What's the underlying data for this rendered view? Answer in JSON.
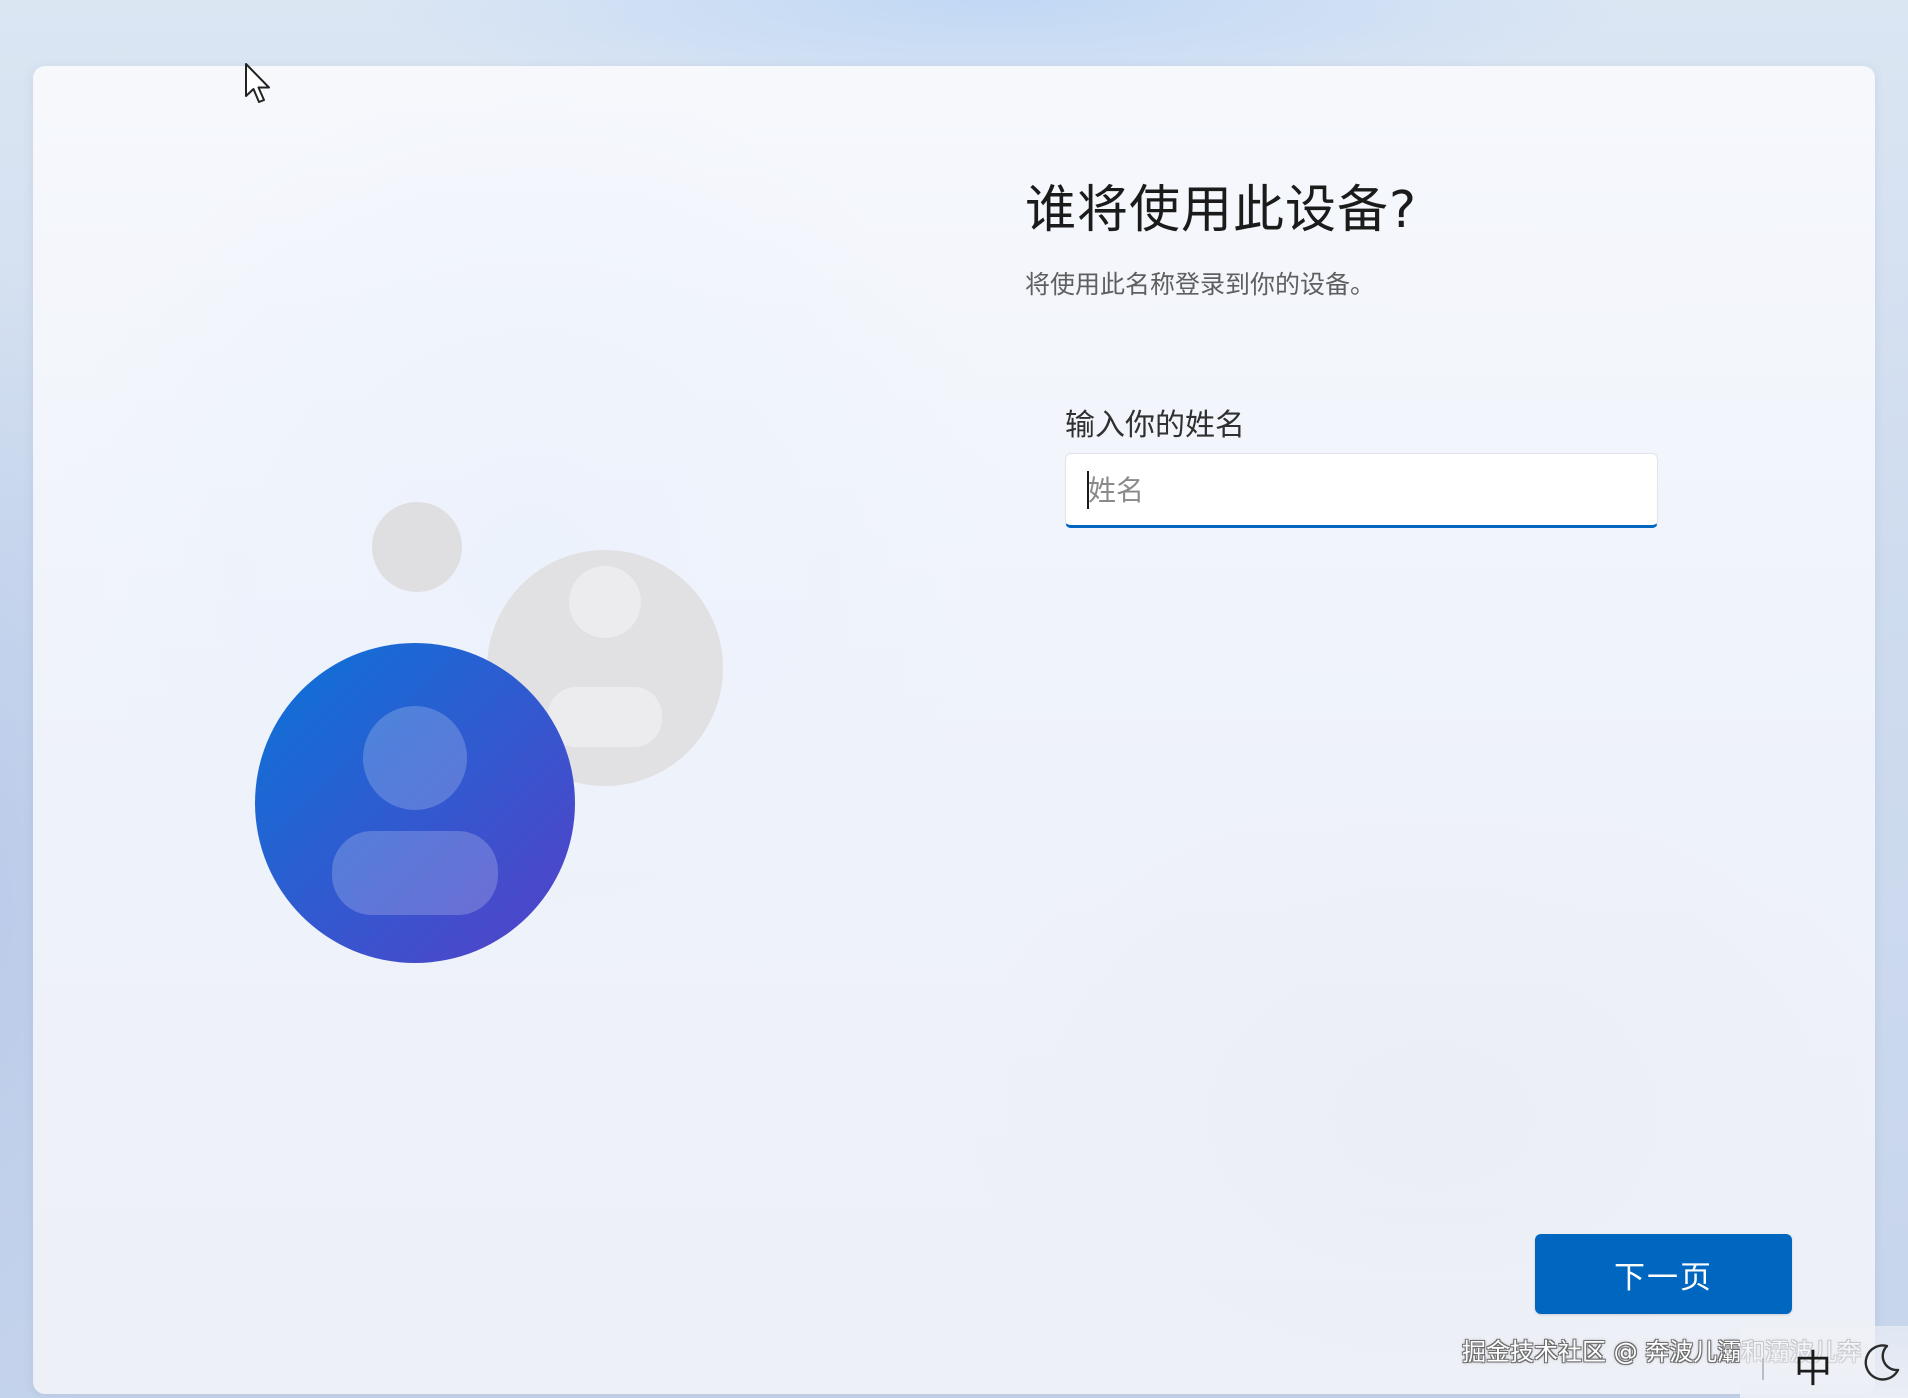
{
  "setup": {
    "title": "谁将使用此设备?",
    "subtitle": "将使用此名称登录到你的设备。",
    "name_label": "输入你的姓名",
    "name_placeholder": "姓名",
    "name_value": "",
    "next_label": "下一页"
  },
  "illustration": {
    "icon": "account-avatars-icon",
    "front_avatar_colors": [
      "#0a74d8",
      "#5640c8"
    ],
    "back_avatar_color": "#e1e1e3"
  },
  "taskbar": {
    "ime_indicator": "中",
    "power_icon": "power-icon"
  },
  "watermark": "掘金技术社区 @ 奔波儿灞和灞波儿奔",
  "colors": {
    "accent": "#0067c0",
    "title": "#1b1b1b",
    "subtitle": "#5f5f5f"
  }
}
